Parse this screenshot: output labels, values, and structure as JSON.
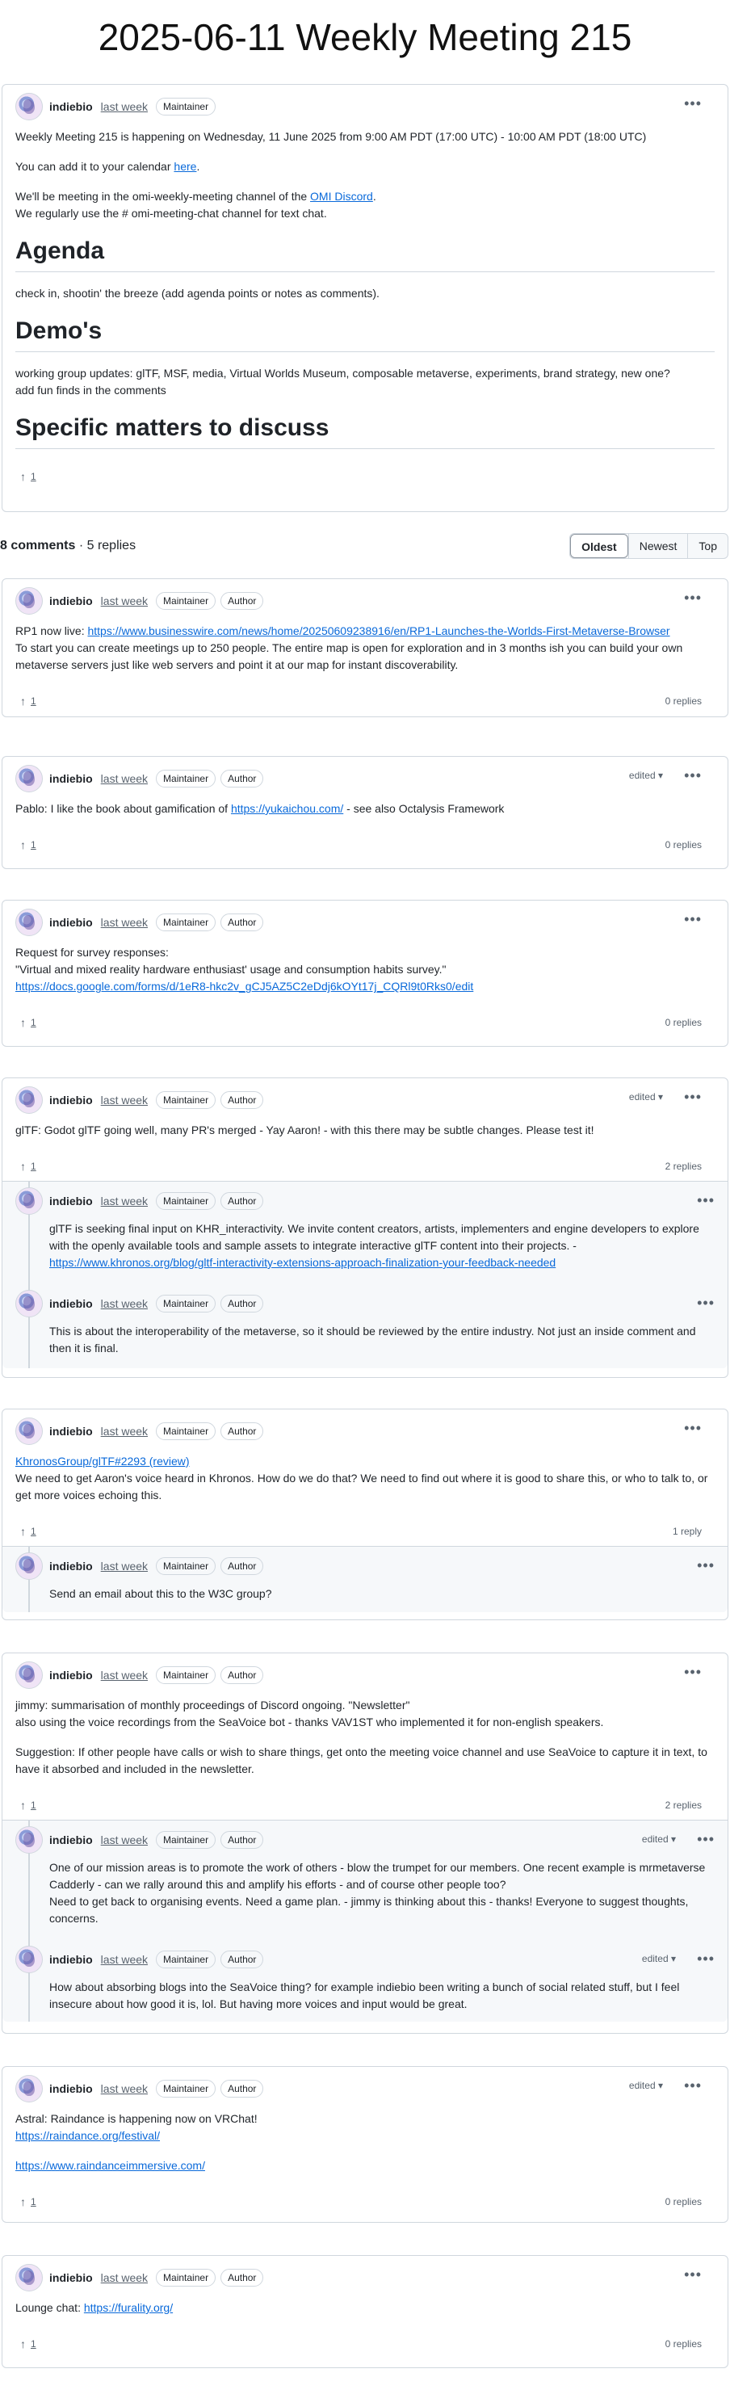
{
  "page_title": "2025-06-11 Weekly Meeting 215",
  "main": {
    "author": "indiebio",
    "time": "last week",
    "badge": "Maintainer",
    "p1": "Weekly Meeting 215 is happening on Wednesday, 11 June 2025 from 9:00 AM PDT (17:00 UTC) - 10:00 AM PDT (18:00 UTC)",
    "p2_pre": "You can add it to your calendar ",
    "p2_link": "here",
    "p2_post": ".",
    "p3_pre": "We'll be meeting in the omi-weekly-meeting channel of the ",
    "p3_link": "OMI Discord",
    "p3_post": ".",
    "p3_line2": "We regularly use the # omi-meeting-chat channel for text chat.",
    "h_agenda": "Agenda",
    "agenda_text": "check in, shootin' the breeze (add agenda points or notes as comments).",
    "h_demos": "Demo's",
    "demos_line1": "working group updates: glTF, MSF, media, Virtual Worlds Museum, composable metaverse, experiments, brand strategy, new one?",
    "demos_line2": "add fun finds in the comments",
    "h_specific": "Specific matters to discuss",
    "upvotes": "1"
  },
  "comments_bar": {
    "count": "8 comments",
    "sep": " · ",
    "replies": "5 replies",
    "sort_options": [
      "Oldest",
      "Newest",
      "Top"
    ],
    "active_sort": "Oldest"
  },
  "common": {
    "author": "indiebio",
    "time": "last week",
    "badge_maintainer": "Maintainer",
    "badge_author": "Author",
    "edited": "edited",
    "upvotes": "1"
  },
  "comments": [
    {
      "link": "https://www.businesswire.com/news/home/20250609238916/en/RP1-Launches-the-Worlds-First-Metaverse-Browser",
      "pre": "RP1 now live: ",
      "text": "To start you can create meetings up to 250 people. The entire map is open for exploration and in 3 months ish you can build your own metaverse servers just like web servers and point it at our map for instant discoverability.",
      "replies": "0 replies"
    },
    {
      "pre": "Pablo: I like the book about gamification of ",
      "link": "https://yukaichou.com/",
      "post": " - see also Octalysis Framework",
      "replies": "0 replies"
    },
    {
      "line1": "Request for survey responses:",
      "line2": "\"Virtual and mixed reality hardware enthusiast' usage and consumption habits survey.\"",
      "link": "https://docs.google.com/forms/d/1eR8-hkc2v_gCJ5AZ5C2eDdj6kOYt17j_CQRl9t0Rks0/edit",
      "replies": "0 replies"
    },
    {
      "text": "glTF: Godot glTF going well, many PR's merged - Yay Aaron! - with this there may be subtle changes. Please test it!",
      "replies": "2 replies",
      "r1_text": "glTF is seeking final input on KHR_interactivity. We invite content creators, artists, implementers and engine developers to explore with the openly available tools and sample assets to integrate interactive glTF content into their projects. -",
      "r1_link": "https://www.khronos.org/blog/gltf-interactivity-extensions-approach-finalization-your-feedback-needed",
      "r2_text": "This is about the interoperability of the metaverse, so it should be reviewed by the entire industry. Not just an inside comment and then it is final."
    },
    {
      "link": "KhronosGroup/glTF#2293 (review)",
      "text": "We need to get Aaron's voice heard in Khronos. How do we do that? We need to find out where it is good to share this, or who to talk to, or get more voices echoing this.",
      "replies": "1 reply",
      "r1_text": "Send an email about this to the W3C group?"
    },
    {
      "line1": "jimmy: summarisation of monthly proceedings of Discord ongoing. \"Newsletter\"",
      "line2": "also using the voice recordings from the SeaVoice bot - thanks VAV1ST who implemented it for non-english speakers.",
      "line3": "Suggestion: If other people have calls or wish to share things, get onto the meeting voice channel and use SeaVoice to capture it in text, to have it absorbed and included in the newsletter.",
      "replies": "2 replies",
      "r1_text": "One of our mission areas is to promote the work of others - blow the trumpet for our members. One recent example is mrmetaverse Cadderly - can we rally around this and amplify his efforts - and of course other people too?",
      "r1_text2": "Need to get back to organising events. Need a game plan. - jimmy is thinking about this - thanks! Everyone to suggest thoughts, concerns.",
      "r2_text": "How about absorbing blogs into the SeaVoice thing? for example indiebio been writing a bunch of social related stuff, but I feel insecure about how good it is, lol. But having more voices and input would be great."
    },
    {
      "line1": "Astral: Raindance is happening now on VRChat!",
      "link1": "https://raindance.org/festival/",
      "link2": "https://www.raindanceimmersive.com/",
      "replies": "0 replies"
    },
    {
      "pre": "Lounge chat: ",
      "link": "https://furality.org/",
      "replies": "0 replies"
    }
  ]
}
